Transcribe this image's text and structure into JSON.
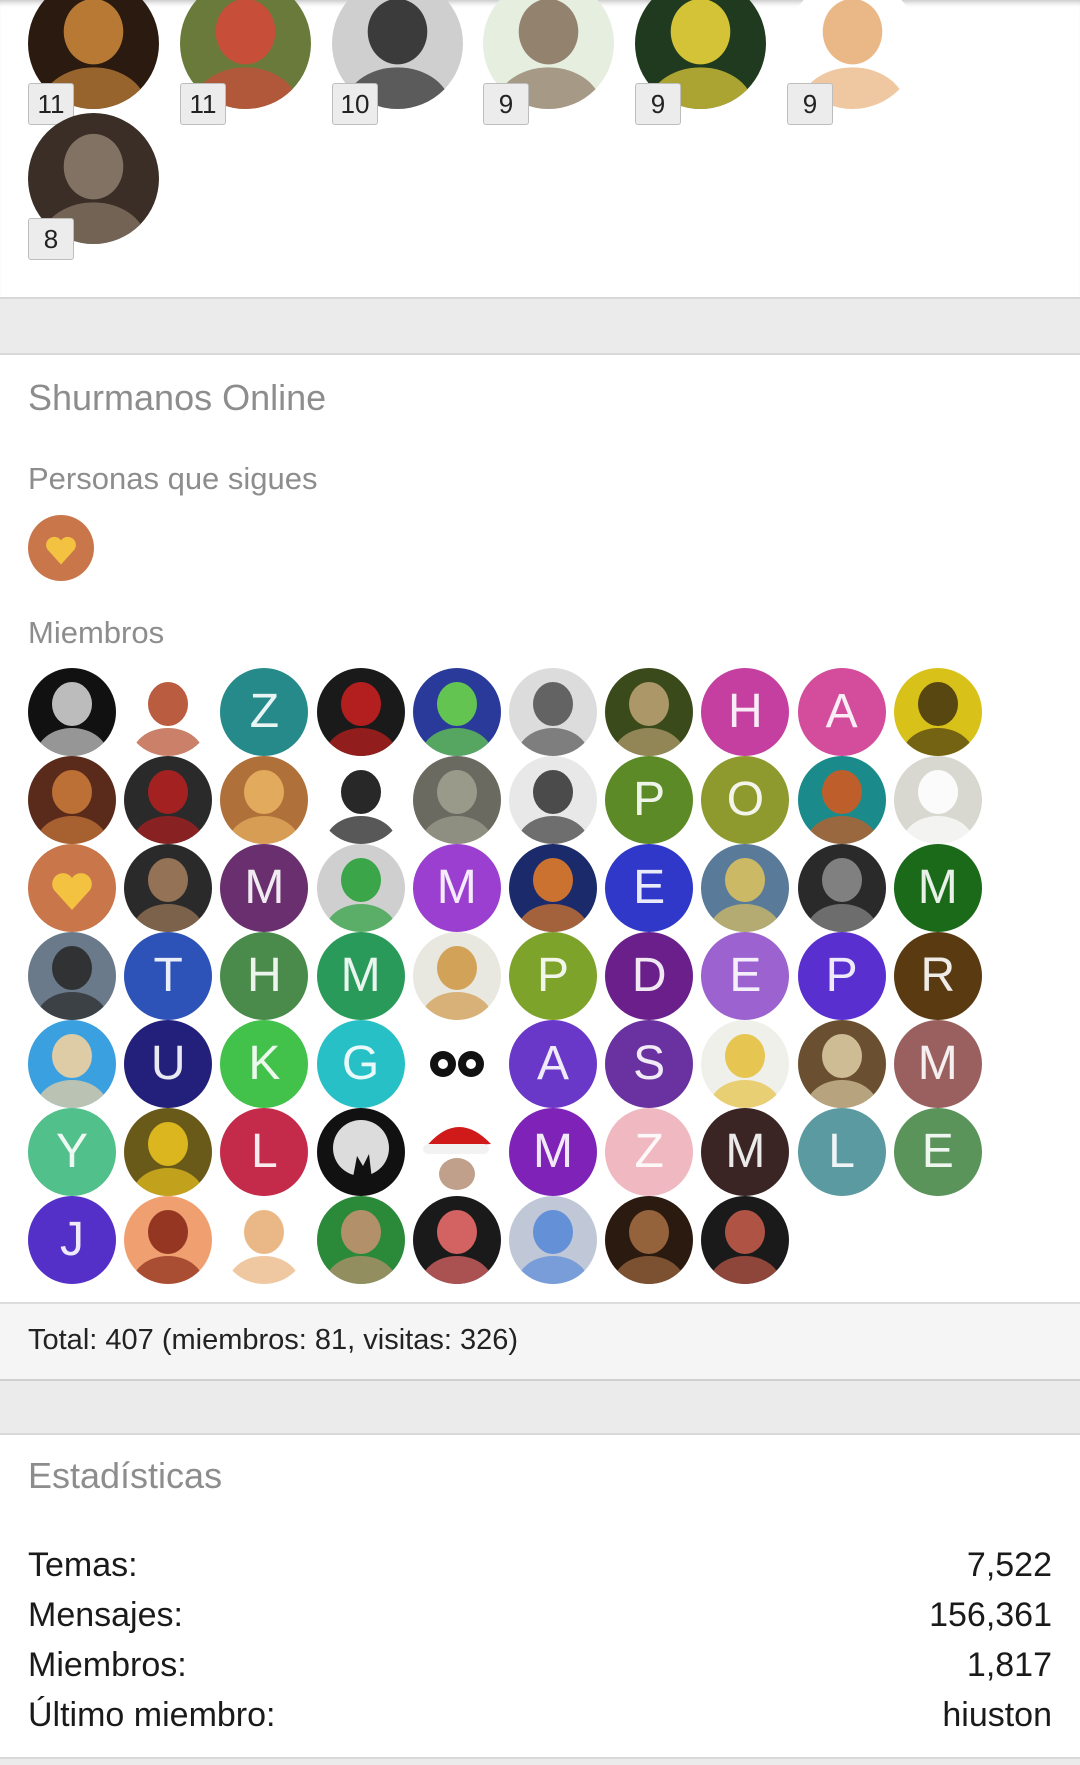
{
  "top_posters": [
    {
      "count": "11",
      "icon": "user-photo-icon",
      "colors": [
        "#2a1a10",
        "#c8843a"
      ]
    },
    {
      "count": "11",
      "icon": "user-photo-icon",
      "colors": [
        "#6a7a3a",
        "#d24a3a"
      ]
    },
    {
      "count": "10",
      "icon": "user-photo-icon",
      "colors": [
        "#cfcfcf",
        "#2a2a2a"
      ]
    },
    {
      "count": "9",
      "icon": "user-photo-icon",
      "colors": [
        "#e6eedf",
        "#8a7560"
      ]
    },
    {
      "count": "9",
      "icon": "user-photo-icon",
      "colors": [
        "#1f3a1f",
        "#e8d23a"
      ]
    },
    {
      "count": "9",
      "icon": "cartoon-face-icon",
      "colors": [
        "#ffffff",
        "#e8b07a"
      ]
    },
    {
      "count": "8",
      "icon": "user-photo-icon",
      "colors": [
        "#3a2e26",
        "#8a7a6a"
      ]
    }
  ],
  "online": {
    "title": "Shurmanos Online",
    "following_title": "Personas que sigues",
    "following": [
      {
        "icon": "heart-photo-icon",
        "colors": [
          "#c9774a",
          "#f4c241"
        ]
      }
    ],
    "members_title": "Miembros",
    "members": [
      {
        "type": "img",
        "icon": "ape-avatar-icon",
        "colors": [
          "#111111",
          "#cfcfcf"
        ]
      },
      {
        "type": "img",
        "icon": "skull-avatar-icon",
        "colors": [
          "#ffffff",
          "#b34a2a"
        ]
      },
      {
        "type": "letter",
        "letter": "Z",
        "color": "#268a8a"
      },
      {
        "type": "img",
        "icon": "santa-avatar-icon",
        "colors": [
          "#1a1a1a",
          "#c42020"
        ]
      },
      {
        "type": "img",
        "icon": "alien-avatar-icon",
        "colors": [
          "#2a3a9a",
          "#69d44a"
        ]
      },
      {
        "type": "img",
        "icon": "monitor-avatar-icon",
        "colors": [
          "#dcdcdc",
          "#555555"
        ]
      },
      {
        "type": "img",
        "icon": "figure-avatar-icon",
        "colors": [
          "#3a4a1a",
          "#b8a070"
        ]
      },
      {
        "type": "letter",
        "letter": "H",
        "color": "#c43fa0"
      },
      {
        "type": "letter",
        "letter": "A",
        "color": "#d44c9c"
      },
      {
        "type": "img",
        "icon": "face-avatar-icon",
        "colors": [
          "#d8c21a",
          "#4a3a10"
        ]
      },
      {
        "type": "img",
        "icon": "movie-avatar-icon",
        "colors": [
          "#5a2a1a",
          "#c8783a"
        ]
      },
      {
        "type": "img",
        "icon": "bottle-avatar-icon",
        "colors": [
          "#2a2a2a",
          "#b02020"
        ]
      },
      {
        "type": "img",
        "icon": "dog-avatar-icon",
        "colors": [
          "#b0703a",
          "#e8b060"
        ]
      },
      {
        "type": "img",
        "icon": "sketch-avatar-icon",
        "colors": [
          "#ffffff",
          "#111111"
        ]
      },
      {
        "type": "img",
        "icon": "rock-avatar-icon",
        "colors": [
          "#6a6a60",
          "#a0a090"
        ]
      },
      {
        "type": "img",
        "icon": "figure-avatar-icon",
        "colors": [
          "#e8e8e8",
          "#3a3a3a"
        ]
      },
      {
        "type": "letter",
        "letter": "P",
        "color": "#5b8a26"
      },
      {
        "type": "letter",
        "letter": "O",
        "color": "#8e9a2e"
      },
      {
        "type": "img",
        "icon": "hedgehog-avatar-icon",
        "colors": [
          "#1a8a8a",
          "#d05a20"
        ]
      },
      {
        "type": "img",
        "icon": "cat-avatar-icon",
        "colors": [
          "#d8d8d0",
          "#ffffff"
        ]
      },
      {
        "type": "img",
        "icon": "heart-photo-icon",
        "colors": [
          "#c9774a",
          "#f4c241"
        ]
      },
      {
        "type": "img",
        "icon": "user-photo-icon",
        "colors": [
          "#2a2a2a",
          "#a07a5a"
        ]
      },
      {
        "type": "letter",
        "letter": "M",
        "color": "#6a2f6e"
      },
      {
        "type": "img",
        "icon": "pen-avatar-icon",
        "colors": [
          "#cfcfcf",
          "#2aa03a"
        ]
      },
      {
        "type": "letter",
        "letter": "M",
        "color": "#9b3fd1"
      },
      {
        "type": "img",
        "icon": "ship-avatar-icon",
        "colors": [
          "#1a2a6a",
          "#e07a2a"
        ]
      },
      {
        "type": "letter",
        "letter": "E",
        "color": "#3038c9"
      },
      {
        "type": "img",
        "icon": "toilet-avatar-icon",
        "colors": [
          "#5a7a9a",
          "#d8c060"
        ]
      },
      {
        "type": "img",
        "icon": "user-photo-icon",
        "colors": [
          "#2a2a2a",
          "#8a8a8a"
        ]
      },
      {
        "type": "letter",
        "letter": "M",
        "color": "#1a6a1a"
      },
      {
        "type": "img",
        "icon": "car-avatar-icon",
        "colors": [
          "#6a7a8a",
          "#2a2a2a"
        ]
      },
      {
        "type": "letter",
        "letter": "T",
        "color": "#2d52b8"
      },
      {
        "type": "letter",
        "letter": "H",
        "color": "#4a8a4a"
      },
      {
        "type": "letter",
        "letter": "M",
        "color": "#2a9a5a"
      },
      {
        "type": "img",
        "icon": "user-photo-icon",
        "colors": [
          "#e8e8e0",
          "#d09a4a"
        ]
      },
      {
        "type": "letter",
        "letter": "P",
        "color": "#7ea32a"
      },
      {
        "type": "letter",
        "letter": "D",
        "color": "#6a1f8a"
      },
      {
        "type": "letter",
        "letter": "E",
        "color": "#9b62d0"
      },
      {
        "type": "letter",
        "letter": "P",
        "color": "#5a2fd0"
      },
      {
        "type": "letter",
        "letter": "R",
        "color": "#5a3a10"
      },
      {
        "type": "img",
        "icon": "cartoon-face-icon",
        "colors": [
          "#3aa0e0",
          "#f0d0a0"
        ]
      },
      {
        "type": "letter",
        "letter": "U",
        "color": "#22207a"
      },
      {
        "type": "letter",
        "letter": "K",
        "color": "#42c24a"
      },
      {
        "type": "letter",
        "letter": "G",
        "color": "#26c0c6"
      },
      {
        "type": "img",
        "icon": "panda-avatar-icon",
        "colors": [
          "#ffffff",
          "#111111"
        ]
      },
      {
        "type": "letter",
        "letter": "A",
        "color": "#6a38c8"
      },
      {
        "type": "letter",
        "letter": "S",
        "color": "#6a32a0"
      },
      {
        "type": "img",
        "icon": "omelette-avatar-icon",
        "colors": [
          "#f0f0ea",
          "#e6c040"
        ]
      },
      {
        "type": "img",
        "icon": "lock-avatar-icon",
        "colors": [
          "#6a5030",
          "#d8c8a0"
        ]
      },
      {
        "type": "letter",
        "letter": "M",
        "color": "#9a6060"
      },
      {
        "type": "letter",
        "letter": "Y",
        "color": "#52c08a"
      },
      {
        "type": "img",
        "icon": "cartoon-face-icon",
        "colors": [
          "#6a5a1a",
          "#e8c020"
        ]
      },
      {
        "type": "letter",
        "letter": "L",
        "color": "#c42a4a"
      },
      {
        "type": "img",
        "icon": "wolf-moon-icon",
        "colors": [
          "#111111",
          "#dcdcdc"
        ]
      },
      {
        "type": "img",
        "icon": "santa-hat-icon",
        "colors": [
          "#ffffff",
          "#d01a1a"
        ]
      },
      {
        "type": "letter",
        "letter": "M",
        "color": "#7e22b8"
      },
      {
        "type": "letter",
        "letter": "Z",
        "color": "#f0b8c0"
      },
      {
        "type": "letter",
        "letter": "M",
        "color": "#3a2424"
      },
      {
        "type": "letter",
        "letter": "L",
        "color": "#5a9aa0"
      },
      {
        "type": "letter",
        "letter": "E",
        "color": "#5a945a"
      },
      {
        "type": "letter",
        "letter": "J",
        "color": "#5530c8"
      },
      {
        "type": "img",
        "icon": "cartoon-face-icon",
        "colors": [
          "#f0a070",
          "#8a2a1a"
        ]
      },
      {
        "type": "img",
        "icon": "cartoon-face-icon",
        "colors": [
          "#ffffff",
          "#e8b07a"
        ]
      },
      {
        "type": "img",
        "icon": "user-photo-icon",
        "colors": [
          "#2a8a3a",
          "#c09070"
        ]
      },
      {
        "type": "img",
        "icon": "pig-avatar-icon",
        "colors": [
          "#1a1a1a",
          "#e86a6a"
        ]
      },
      {
        "type": "img",
        "icon": "cartoon-face-icon",
        "colors": [
          "#c0c8d8",
          "#5a8ad8"
        ]
      },
      {
        "type": "img",
        "icon": "face-avatar-icon",
        "colors": [
          "#2a1a10",
          "#a06a40"
        ]
      },
      {
        "type": "img",
        "icon": "robot-face-icon",
        "colors": [
          "#1a1a1a",
          "#c05a4a"
        ]
      }
    ],
    "total": "Total: 407 (miembros: 81, visitas: 326)"
  },
  "stats": {
    "title": "Estadísticas",
    "rows": [
      {
        "label": "Temas:",
        "value": "7,522"
      },
      {
        "label": "Mensajes:",
        "value": "156,361"
      },
      {
        "label": "Miembros:",
        "value": "1,817"
      },
      {
        "label": "Último miembro:",
        "value": "hiuston"
      }
    ]
  }
}
